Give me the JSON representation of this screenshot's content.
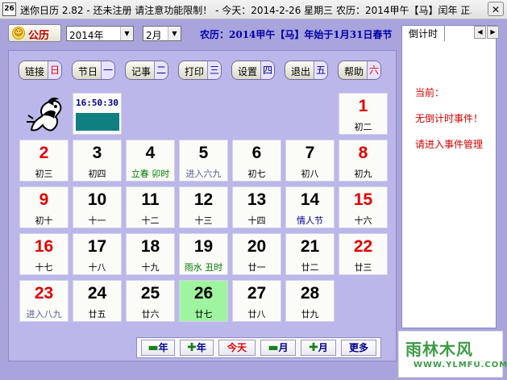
{
  "window": {
    "title": "迷你日历 2.82 - 还未注册 请注意功能限制！ - 今天：2014-2-26 星期三 农历：2014甲午【马】闰年 正...",
    "icon_label": "26",
    "close_label": "✕"
  },
  "toolbar": {
    "lunar_button": "公历",
    "year_value": "2014年",
    "month_value": "2月",
    "lunar_info": "农历：2014甲午【马】年始于1月31日春节"
  },
  "func_buttons": [
    {
      "label": "链接",
      "day": "日",
      "day_color": "#e00000"
    },
    {
      "label": "节日",
      "day": "一",
      "day_color": "#00008e"
    },
    {
      "label": "记事",
      "day": "二",
      "day_color": "#00008e"
    },
    {
      "label": "打印",
      "day": "三",
      "day_color": "#00008e"
    },
    {
      "label": "设置",
      "day": "四",
      "day_color": "#00008e"
    },
    {
      "label": "退出",
      "day": "五",
      "day_color": "#00008e"
    },
    {
      "label": "帮助",
      "day": "六",
      "day_color": "#e00000"
    }
  ],
  "clock": {
    "time": "16:50:30"
  },
  "days": [
    {
      "n": "1",
      "s": "初二",
      "red": true
    },
    {
      "n": "2",
      "s": "初三",
      "red": true
    },
    {
      "n": "3",
      "s": "初四"
    },
    {
      "n": "4",
      "s": "立春    卯时",
      "sc": "green"
    },
    {
      "n": "5",
      "s": "进入六九",
      "sc": "bluegray"
    },
    {
      "n": "6",
      "s": "初七"
    },
    {
      "n": "7",
      "s": "初八"
    },
    {
      "n": "8",
      "s": "初九",
      "red": true
    },
    {
      "n": "9",
      "s": "初十",
      "red": true
    },
    {
      "n": "10",
      "s": "十一"
    },
    {
      "n": "11",
      "s": "十二"
    },
    {
      "n": "12",
      "s": "十三"
    },
    {
      "n": "13",
      "s": "十四"
    },
    {
      "n": "14",
      "s": "情人节",
      "sc": "blue"
    },
    {
      "n": "15",
      "s": "十六",
      "red": true
    },
    {
      "n": "16",
      "s": "十七",
      "red": true
    },
    {
      "n": "17",
      "s": "十八"
    },
    {
      "n": "18",
      "s": "十九"
    },
    {
      "n": "19",
      "s": "雨水    丑时",
      "sc": "green"
    },
    {
      "n": "20",
      "s": "廿一"
    },
    {
      "n": "21",
      "s": "廿二"
    },
    {
      "n": "22",
      "s": "廿三",
      "red": true
    },
    {
      "n": "23",
      "s": "进入八九",
      "red": true,
      "sc": "bluegray"
    },
    {
      "n": "24",
      "s": "廿五"
    },
    {
      "n": "25",
      "s": "廿六"
    },
    {
      "n": "26",
      "s": "廿七",
      "today": true
    },
    {
      "n": "27",
      "s": "廿八"
    },
    {
      "n": "28",
      "s": "廿九"
    }
  ],
  "nav": {
    "prev_year": "年",
    "next_year": "年",
    "today": "今天",
    "prev_month": "月",
    "next_month": "月",
    "more": "更多",
    "minus_symbol": "▬",
    "plus_symbol": "✚"
  },
  "right_panel": {
    "tab_label": "倒计时",
    "current_label": "当前：",
    "no_events": "无倒计时事件！",
    "enter_events": "请进入事件管理"
  },
  "watermark": {
    "title": "雨林木风",
    "url": "WWW.YLMFU.COM"
  }
}
